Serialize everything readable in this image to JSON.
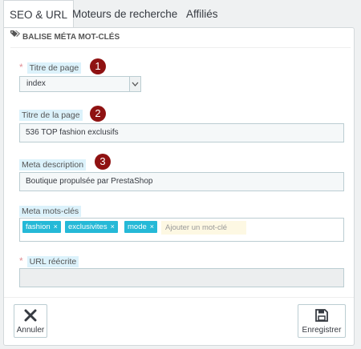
{
  "tabs": [
    {
      "label": "SEO & URL"
    },
    {
      "label": "Moteurs de recherche"
    },
    {
      "label": "Affiliés"
    }
  ],
  "panel": {
    "title": "BALISE MÉTA MOT-CLÉS"
  },
  "fields": {
    "page_title": {
      "required_mark": "*",
      "label": "Titre de page",
      "value": "index",
      "badge": "1"
    },
    "title": {
      "label": "Titre de la page",
      "value": "536 TOP fashion exclusifs",
      "badge": "2"
    },
    "description": {
      "label": "Meta description",
      "value": "Boutique propulsée par PrestaShop",
      "badge": "3"
    },
    "keywords": {
      "label": "Meta mots-clés",
      "tags": [
        "fashion",
        "exclusivites",
        "mode"
      ],
      "remove_glyph": "×",
      "placeholder": "Ajouter un mot-clé"
    },
    "url": {
      "required_mark": "*",
      "label": "URL réécrite",
      "value": ""
    }
  },
  "buttons": {
    "cancel": "Annuler",
    "save": "Enregistrer"
  },
  "colors": {
    "accent": "#25b9d7",
    "badge": "#8f1212",
    "required": "#e08f95"
  }
}
